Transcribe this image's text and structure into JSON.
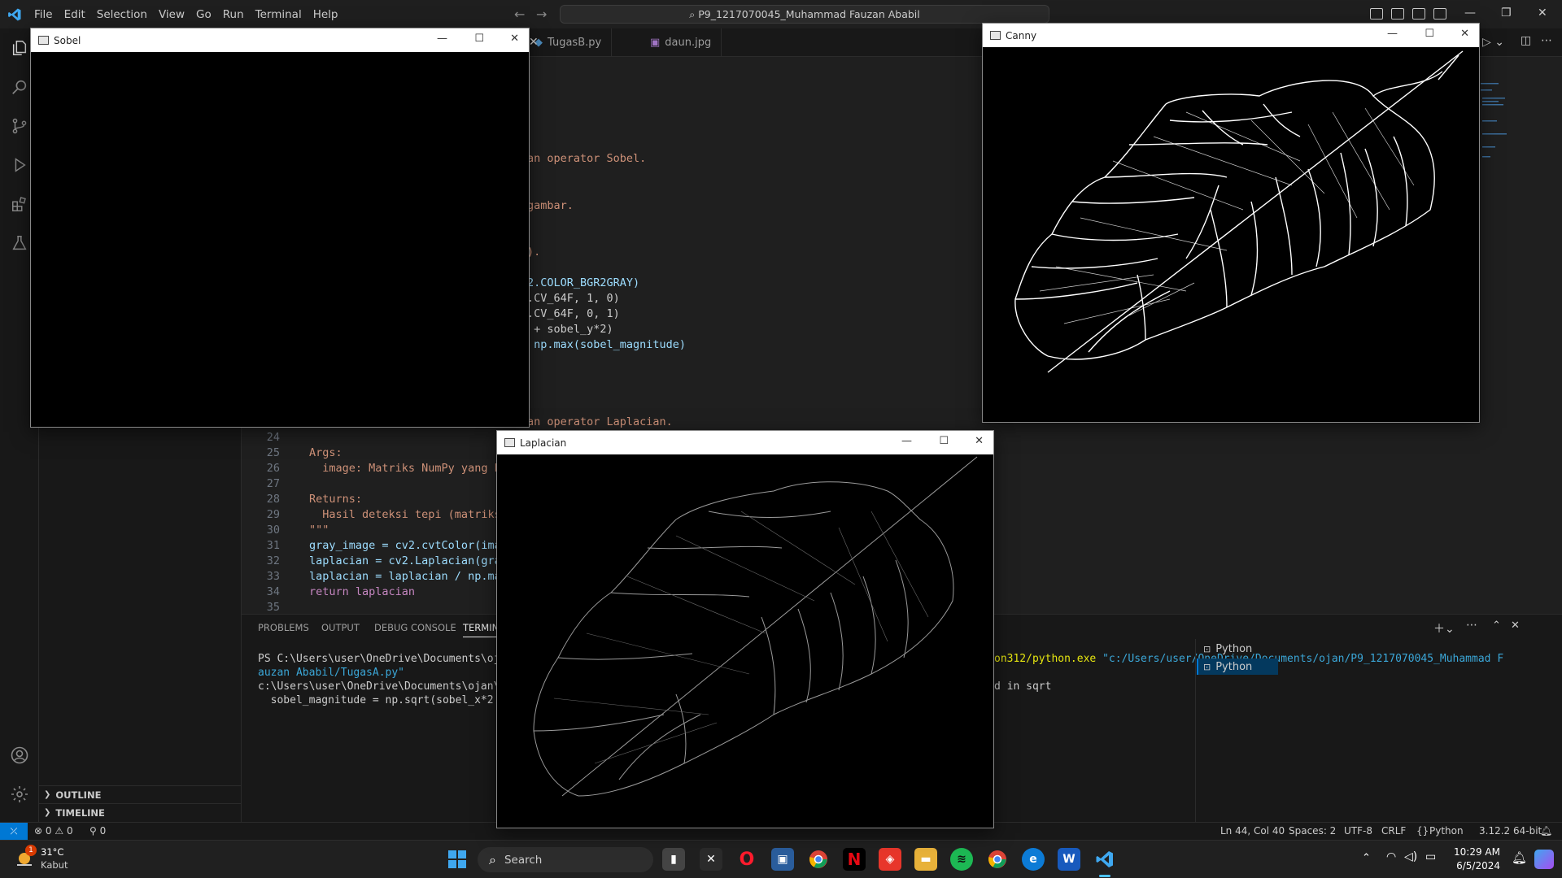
{
  "titlebar": {
    "menus": [
      "File",
      "Edit",
      "Selection",
      "View",
      "Go",
      "Run",
      "Terminal",
      "Help"
    ],
    "search_text": "P9_1217070045_Muhammad Fauzan Ababil"
  },
  "tabs": [
    {
      "label": "TugasB.py"
    },
    {
      "label": "daun.jpg"
    }
  ],
  "editor": {
    "partial_lines": [
      {
        "text": "an operator Sobel."
      },
      {
        "text": "gambar."
      },
      {
        "text": ")."
      },
      {
        "text": "2.COLOR_BGR2GRAY)"
      },
      {
        "text": ".CV_64F, 1, 0)"
      },
      {
        "text": ".CV_64F, 0, 1)"
      },
      {
        "text": " + sobel_y*2)"
      },
      {
        "text": " np.max(sobel_magnitude)"
      },
      {
        "text": "an operator Laplacian."
      }
    ],
    "lines": [
      {
        "n": "24",
        "text": ""
      },
      {
        "n": "25",
        "text": "Args:"
      },
      {
        "n": "26",
        "text": "  image: Matriks NumPy yang be"
      },
      {
        "n": "27",
        "text": ""
      },
      {
        "n": "28",
        "text": "Returns:"
      },
      {
        "n": "29",
        "text": "  Hasil deteksi tepi (matriks"
      },
      {
        "n": "30",
        "text": "\"\"\""
      },
      {
        "n": "31",
        "text": "gray_image = cv2.cvtColor(imag"
      },
      {
        "n": "32",
        "text": "laplacian = cv2.Laplacian(gray"
      },
      {
        "n": "33",
        "text": "laplacian = laplacian / np.max"
      },
      {
        "n": "34",
        "text": "return laplacian"
      },
      {
        "n": "35",
        "text": ""
      }
    ]
  },
  "panel": {
    "tabs": [
      "PROBLEMS",
      "OUTPUT",
      "DEBUG CONSOLE",
      "TERMINA"
    ],
    "terminal_left": [
      "PS C:\\Users\\user\\OneDrive\\Documents\\ojan\\P",
      "auzan Ababil/TugasA.py\"",
      "c:\\Users\\user\\OneDrive\\Documents\\ojan\\P9_1",
      "  sobel_magnitude = np.sqrt(sobel_x*2 + so"
    ],
    "terminal_right_1a": "on312/python.exe ",
    "terminal_right_1b": "\"c:/Users/user/OneDrive/Documents/ojan/P9_1217070045_Muhammad F",
    "terminal_right_2": "d in sqrt",
    "terminal_instances": [
      "Python",
      "Python"
    ]
  },
  "sidebar": {
    "sections": [
      "OUTLINE",
      "TIMELINE"
    ]
  },
  "statusbar": {
    "errors": "0",
    "warnings": "0",
    "ports": "0",
    "position": "Ln 44, Col 40",
    "spaces": "Spaces: 2",
    "encoding": "UTF-8",
    "eol": "CRLF",
    "language": "Python",
    "interpreter": "3.12.2 64-bit"
  },
  "taskbar": {
    "weather_temp": "31°C",
    "weather_desc": "Kabut",
    "weather_badge": "1",
    "search_placeholder": "Search",
    "time": "10:29 AM",
    "date": "6/5/2024"
  },
  "windows": {
    "sobel": {
      "title": "Sobel"
    },
    "canny": {
      "title": "Canny"
    },
    "laplacian": {
      "title": "Laplacian"
    }
  },
  "colors": {
    "accent": "#0078d4",
    "string": "#ce9178",
    "keyword": "#c586c0",
    "function": "#dcdcaa",
    "variable": "#9cdcfe"
  }
}
